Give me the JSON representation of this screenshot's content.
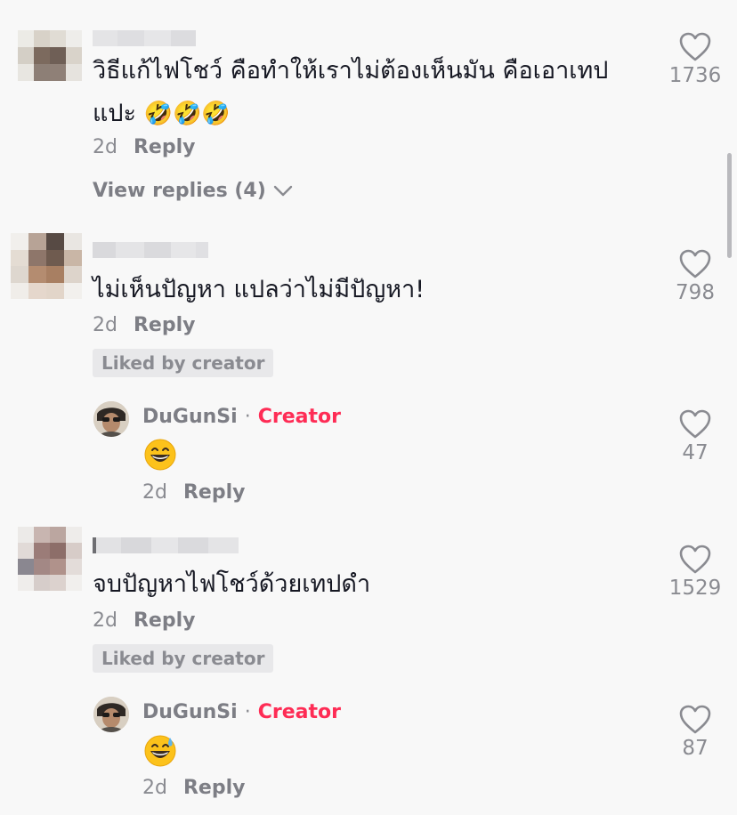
{
  "comments": [
    {
      "text_line1": "วิธีแก้ไฟโชว์ คือทำให้เราไม่ต้องเห็นมัน คือเอาเทป",
      "text_line2": "แปะ",
      "emoji": "🤣🤣🤣",
      "time": "2d",
      "reply_label": "Reply",
      "view_replies": "View replies (4)",
      "likes": "1736"
    },
    {
      "text": "ไม่เห็นปัญหา แปลว่าไม่มีปัญหา!",
      "time": "2d",
      "reply_label": "Reply",
      "liked_badge": "Liked by creator",
      "likes": "798",
      "reply": {
        "username": "DuGunSi",
        "separator": "·",
        "badge": "Creator",
        "emoji": "😁",
        "time": "2d",
        "reply_label": "Reply",
        "likes": "47"
      }
    },
    {
      "text": "จบปัญหาไฟโชว์ด้วยเทปดำ",
      "time": "2d",
      "reply_label": "Reply",
      "liked_badge": "Liked by creator",
      "likes": "1529",
      "reply": {
        "username": "DuGunSi",
        "separator": "·",
        "badge": "Creator",
        "emoji": "😅",
        "time": "2d",
        "reply_label": "Reply",
        "likes": "87"
      }
    }
  ],
  "icons": {
    "like": "heart-outline-icon",
    "expand": "chevron-down-icon"
  },
  "colors": {
    "creator_badge": "#fe2c55",
    "secondary_text": "#8a8b91",
    "background": "#f8f8f8"
  }
}
